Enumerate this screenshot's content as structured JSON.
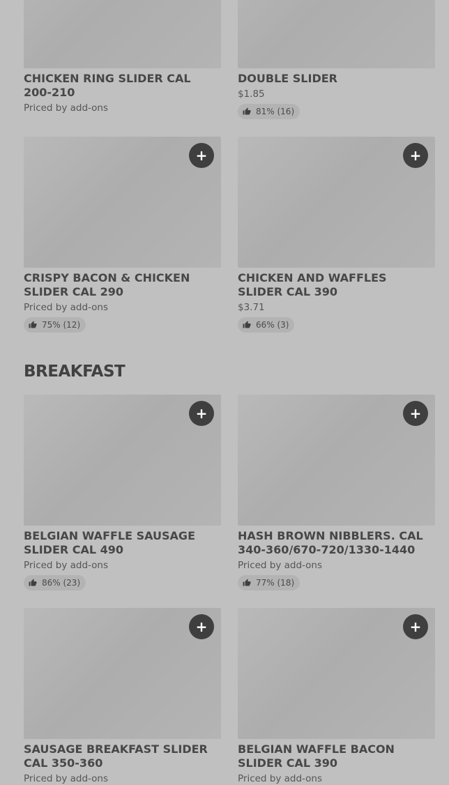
{
  "section": {
    "title": "BREAKFAST"
  },
  "items": [
    {
      "title": "CHICKEN RING SLIDER CAL 200-210",
      "price": "Priced by add-ons",
      "rating": ""
    },
    {
      "title": "DOUBLE SLIDER",
      "price": "$1.85",
      "rating": "81% (16)"
    },
    {
      "title": "CRISPY BACON & CHICKEN SLIDER CAL 290",
      "price": "Priced by add-ons",
      "rating": "75% (12)"
    },
    {
      "title": "CHICKEN AND WAFFLES SLIDER CAL 390",
      "price": "$3.71",
      "rating": "66% (3)"
    },
    {
      "title": "BELGIAN WAFFLE SAUSAGE SLIDER CAL 490",
      "price": "Priced by add-ons",
      "rating": "86% (23)"
    },
    {
      "title": "HASH BROWN NIBBLERS. CAL 340-360/670-720/1330-1440",
      "price": "Priced by add-ons",
      "rating": "77% (18)"
    },
    {
      "title": "SAUSAGE BREAKFAST SLIDER CAL 350-360",
      "price": "Priced by add-ons",
      "rating": ""
    },
    {
      "title": "BELGIAN WAFFLE BACON SLIDER CAL 390",
      "price": "Priced by add-ons",
      "rating": ""
    }
  ],
  "icons": {
    "add": "plus-icon",
    "rating": "thumbs-up-icon"
  },
  "colors": {
    "background": "#c0c0c0",
    "image_placeholder": "#b0b0b0",
    "add_button": "#3f3f3f",
    "rating_pill": "#b3b3b3",
    "text": "#454545"
  }
}
